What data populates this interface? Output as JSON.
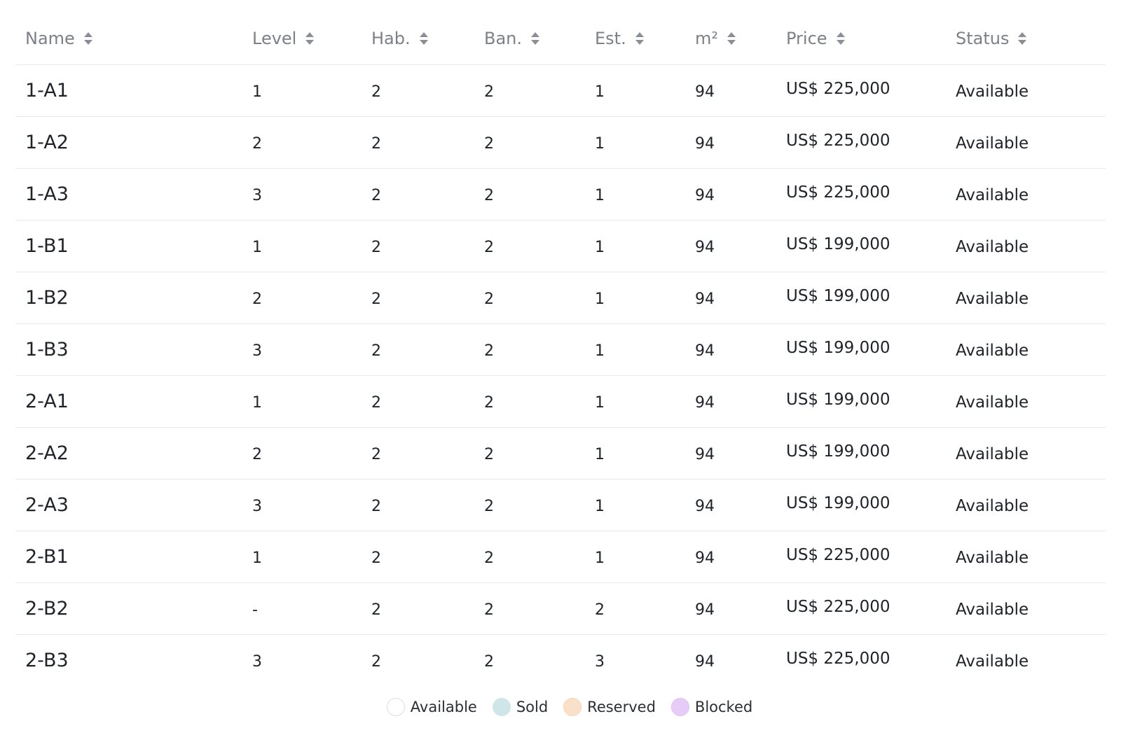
{
  "table": {
    "headers": [
      {
        "key": "name",
        "label": "Name"
      },
      {
        "key": "level",
        "label": "Level"
      },
      {
        "key": "hab",
        "label": "Hab."
      },
      {
        "key": "ban",
        "label": "Ban."
      },
      {
        "key": "est",
        "label": "Est."
      },
      {
        "key": "m2",
        "label": "m²"
      },
      {
        "key": "price",
        "label": "Price"
      },
      {
        "key": "status",
        "label": "Status"
      }
    ],
    "rows": [
      {
        "name": "1-A1",
        "level": "1",
        "hab": "2",
        "ban": "2",
        "est": "1",
        "m2": "94",
        "price": "US$ 225,000",
        "status": "Available"
      },
      {
        "name": "1-A2",
        "level": "2",
        "hab": "2",
        "ban": "2",
        "est": "1",
        "m2": "94",
        "price": "US$ 225,000",
        "status": "Available"
      },
      {
        "name": "1-A3",
        "level": "3",
        "hab": "2",
        "ban": "2",
        "est": "1",
        "m2": "94",
        "price": "US$ 225,000",
        "status": "Available"
      },
      {
        "name": "1-B1",
        "level": "1",
        "hab": "2",
        "ban": "2",
        "est": "1",
        "m2": "94",
        "price": "US$ 199,000",
        "status": "Available"
      },
      {
        "name": "1-B2",
        "level": "2",
        "hab": "2",
        "ban": "2",
        "est": "1",
        "m2": "94",
        "price": "US$ 199,000",
        "status": "Available"
      },
      {
        "name": "1-B3",
        "level": "3",
        "hab": "2",
        "ban": "2",
        "est": "1",
        "m2": "94",
        "price": "US$ 199,000",
        "status": "Available"
      },
      {
        "name": "2-A1",
        "level": "1",
        "hab": "2",
        "ban": "2",
        "est": "1",
        "m2": "94",
        "price": "US$ 199,000",
        "status": "Available"
      },
      {
        "name": "2-A2",
        "level": "2",
        "hab": "2",
        "ban": "2",
        "est": "1",
        "m2": "94",
        "price": "US$ 199,000",
        "status": "Available"
      },
      {
        "name": "2-A3",
        "level": "3",
        "hab": "2",
        "ban": "2",
        "est": "1",
        "m2": "94",
        "price": "US$ 199,000",
        "status": "Available"
      },
      {
        "name": "2-B1",
        "level": "1",
        "hab": "2",
        "ban": "2",
        "est": "1",
        "m2": "94",
        "price": "US$ 225,000",
        "status": "Available"
      },
      {
        "name": "2-B2",
        "level": "-",
        "hab": "2",
        "ban": "2",
        "est": "2",
        "m2": "94",
        "price": "US$ 225,000",
        "status": "Available"
      },
      {
        "name": "2-B3",
        "level": "3",
        "hab": "2",
        "ban": "2",
        "est": "3",
        "m2": "94",
        "price": "US$ 225,000",
        "status": "Available"
      }
    ]
  },
  "legend": [
    {
      "label": "Available",
      "color": "#ffffff",
      "border": "#d9dde2"
    },
    {
      "label": "Sold",
      "color": "#cfe6e8",
      "border": "#cfe6e8"
    },
    {
      "label": "Reserved",
      "color": "#fbe0c9",
      "border": "#f6d6bb"
    },
    {
      "label": "Blocked",
      "color": "#e7ccf7",
      "border": "#e0c1f3"
    }
  ],
  "colors": {
    "header_text": "#7b8089",
    "sort_icon": "#8a8f97",
    "row_divider": "#e6e8eb"
  }
}
